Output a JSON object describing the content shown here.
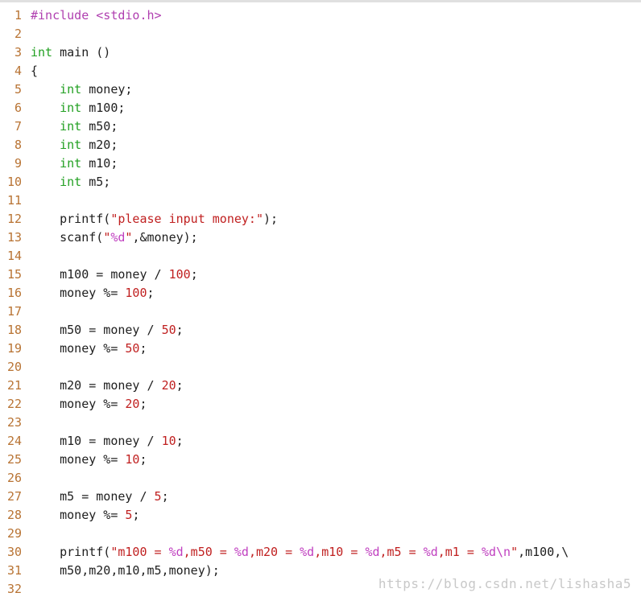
{
  "editor": {
    "lines": [
      {
        "n": "1",
        "tokens": [
          {
            "t": "#include <stdio.h>",
            "k": "pp"
          }
        ]
      },
      {
        "n": "2",
        "tokens": []
      },
      {
        "n": "3",
        "tokens": [
          {
            "t": "int",
            "k": "kw"
          },
          {
            "t": " main ()",
            "k": "plain"
          }
        ]
      },
      {
        "n": "4",
        "tokens": [
          {
            "t": "{",
            "k": "plain"
          }
        ]
      },
      {
        "n": "5",
        "tokens": [
          {
            "t": "    ",
            "k": "plain"
          },
          {
            "t": "int",
            "k": "kw"
          },
          {
            "t": " money;",
            "k": "plain"
          }
        ]
      },
      {
        "n": "6",
        "tokens": [
          {
            "t": "    ",
            "k": "plain"
          },
          {
            "t": "int",
            "k": "kw"
          },
          {
            "t": " m100;",
            "k": "plain"
          }
        ]
      },
      {
        "n": "7",
        "tokens": [
          {
            "t": "    ",
            "k": "plain"
          },
          {
            "t": "int",
            "k": "kw"
          },
          {
            "t": " m50;",
            "k": "plain"
          }
        ]
      },
      {
        "n": "8",
        "tokens": [
          {
            "t": "    ",
            "k": "plain"
          },
          {
            "t": "int",
            "k": "kw"
          },
          {
            "t": " m20;",
            "k": "plain"
          }
        ]
      },
      {
        "n": "9",
        "tokens": [
          {
            "t": "    ",
            "k": "plain"
          },
          {
            "t": "int",
            "k": "kw"
          },
          {
            "t": " m10;",
            "k": "plain"
          }
        ]
      },
      {
        "n": "10",
        "tokens": [
          {
            "t": "    ",
            "k": "plain"
          },
          {
            "t": "int",
            "k": "kw"
          },
          {
            "t": " m5;",
            "k": "plain"
          }
        ]
      },
      {
        "n": "11",
        "tokens": []
      },
      {
        "n": "12",
        "tokens": [
          {
            "t": "    printf(",
            "k": "plain"
          },
          {
            "t": "\"please input money:\"",
            "k": "str"
          },
          {
            "t": ");",
            "k": "plain"
          }
        ]
      },
      {
        "n": "13",
        "tokens": [
          {
            "t": "    scanf(",
            "k": "plain"
          },
          {
            "t": "\"",
            "k": "str"
          },
          {
            "t": "%d",
            "k": "fmt"
          },
          {
            "t": "\"",
            "k": "str"
          },
          {
            "t": ",&money);",
            "k": "plain"
          }
        ]
      },
      {
        "n": "14",
        "tokens": []
      },
      {
        "n": "15",
        "tokens": [
          {
            "t": "    m100 = money / ",
            "k": "plain"
          },
          {
            "t": "100",
            "k": "num"
          },
          {
            "t": ";",
            "k": "plain"
          }
        ]
      },
      {
        "n": "16",
        "tokens": [
          {
            "t": "    money %= ",
            "k": "plain"
          },
          {
            "t": "100",
            "k": "num"
          },
          {
            "t": ";",
            "k": "plain"
          }
        ]
      },
      {
        "n": "17",
        "tokens": []
      },
      {
        "n": "18",
        "tokens": [
          {
            "t": "    m50 = money / ",
            "k": "plain"
          },
          {
            "t": "50",
            "k": "num"
          },
          {
            "t": ";",
            "k": "plain"
          }
        ]
      },
      {
        "n": "19",
        "tokens": [
          {
            "t": "    money %= ",
            "k": "plain"
          },
          {
            "t": "50",
            "k": "num"
          },
          {
            "t": ";",
            "k": "plain"
          }
        ]
      },
      {
        "n": "20",
        "tokens": []
      },
      {
        "n": "21",
        "tokens": [
          {
            "t": "    m20 = money / ",
            "k": "plain"
          },
          {
            "t": "20",
            "k": "num"
          },
          {
            "t": ";",
            "k": "plain"
          }
        ]
      },
      {
        "n": "22",
        "tokens": [
          {
            "t": "    money %= ",
            "k": "plain"
          },
          {
            "t": "20",
            "k": "num"
          },
          {
            "t": ";",
            "k": "plain"
          }
        ]
      },
      {
        "n": "23",
        "tokens": []
      },
      {
        "n": "24",
        "tokens": [
          {
            "t": "    m10 = money / ",
            "k": "plain"
          },
          {
            "t": "10",
            "k": "num"
          },
          {
            "t": ";",
            "k": "plain"
          }
        ]
      },
      {
        "n": "25",
        "tokens": [
          {
            "t": "    money %= ",
            "k": "plain"
          },
          {
            "t": "10",
            "k": "num"
          },
          {
            "t": ";",
            "k": "plain"
          }
        ]
      },
      {
        "n": "26",
        "tokens": []
      },
      {
        "n": "27",
        "tokens": [
          {
            "t": "    m5 = money / ",
            "k": "plain"
          },
          {
            "t": "5",
            "k": "num"
          },
          {
            "t": ";",
            "k": "plain"
          }
        ]
      },
      {
        "n": "28",
        "tokens": [
          {
            "t": "    money %= ",
            "k": "plain"
          },
          {
            "t": "5",
            "k": "num"
          },
          {
            "t": ";",
            "k": "plain"
          }
        ]
      },
      {
        "n": "29",
        "tokens": []
      },
      {
        "n": "30",
        "tokens": [
          {
            "t": "    printf(",
            "k": "plain"
          },
          {
            "t": "\"m100 = ",
            "k": "str"
          },
          {
            "t": "%d",
            "k": "fmt"
          },
          {
            "t": ",m50 = ",
            "k": "str"
          },
          {
            "t": "%d",
            "k": "fmt"
          },
          {
            "t": ",m20 = ",
            "k": "str"
          },
          {
            "t": "%d",
            "k": "fmt"
          },
          {
            "t": ",m10 = ",
            "k": "str"
          },
          {
            "t": "%d",
            "k": "fmt"
          },
          {
            "t": ",m5 = ",
            "k": "str"
          },
          {
            "t": "%d",
            "k": "fmt"
          },
          {
            "t": ",m1 = ",
            "k": "str"
          },
          {
            "t": "%d\\n",
            "k": "fmt"
          },
          {
            "t": "\"",
            "k": "str"
          },
          {
            "t": ",m100,\\",
            "k": "plain"
          }
        ]
      },
      {
        "n": "31",
        "tokens": [
          {
            "t": "    m50,m20,m10,m5,money);",
            "k": "plain"
          }
        ]
      },
      {
        "n": "32",
        "tokens": []
      }
    ]
  },
  "watermark": "https://blog.csdn.net/lishasha5",
  "colors": {
    "line_number": "#b87333",
    "keyword": "#22a022",
    "string": "#c02020",
    "number": "#c02020",
    "format_spec": "#c040c0",
    "preprocessor": "#b040b0",
    "text": "#202020"
  }
}
